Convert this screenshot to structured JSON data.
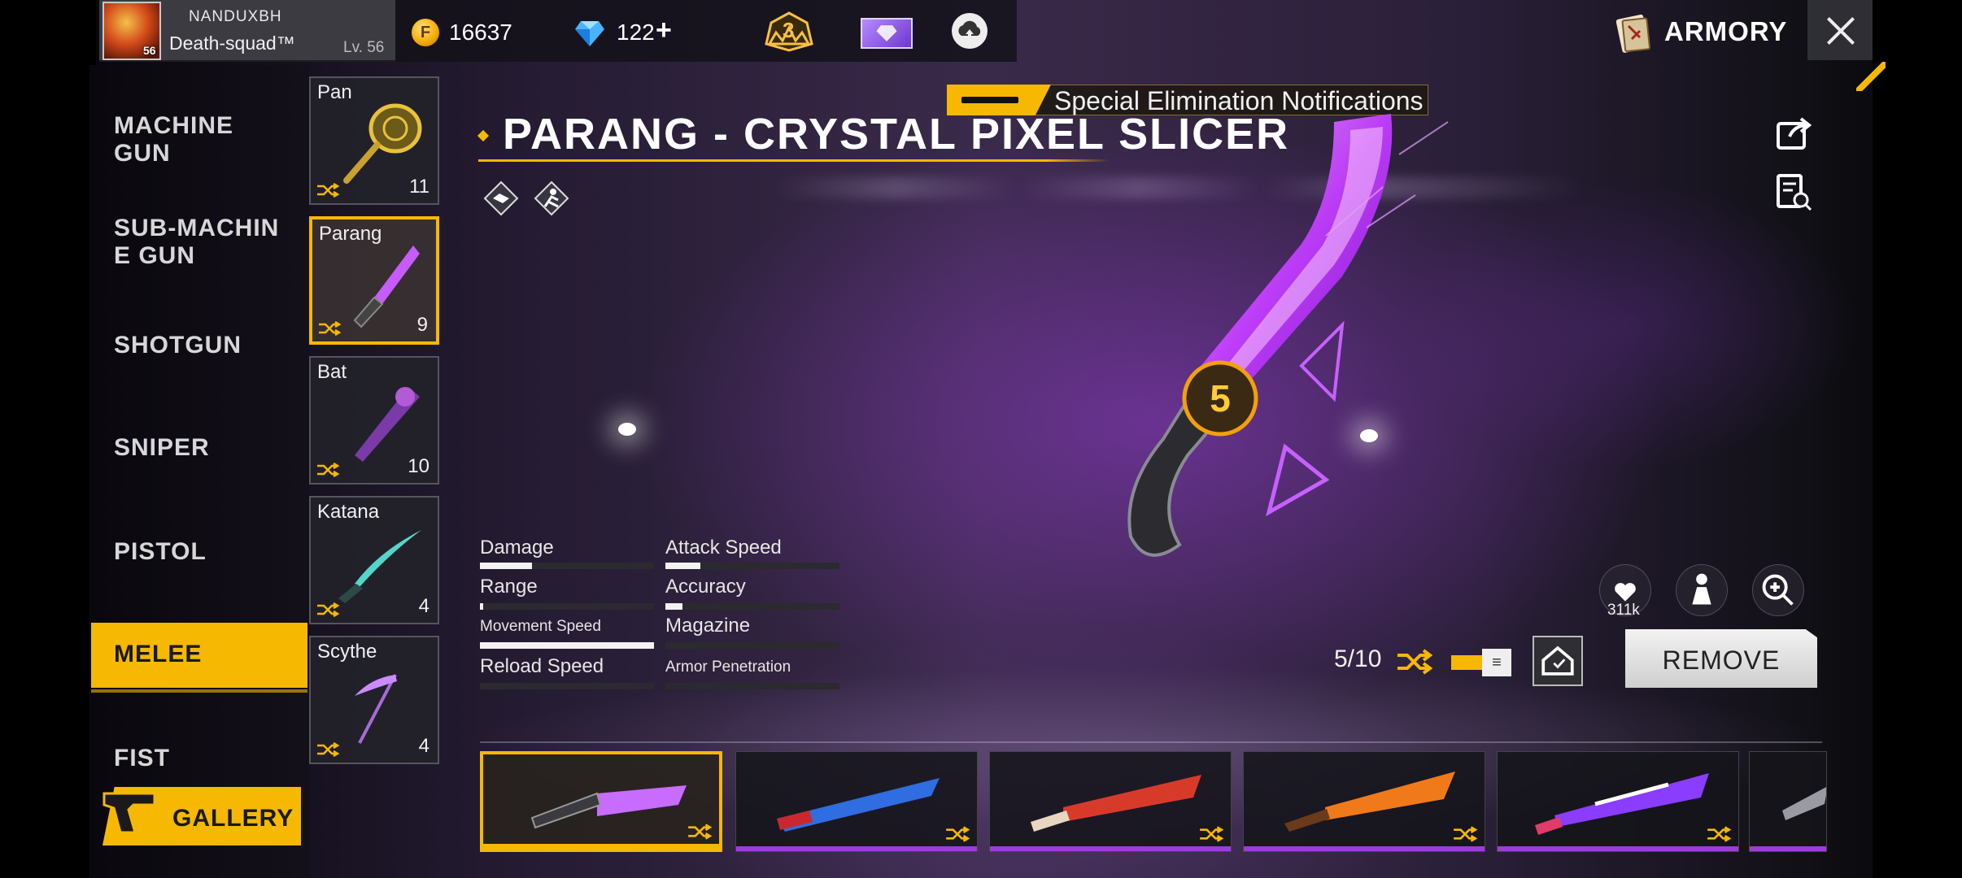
{
  "profile": {
    "name": "NANDUXBH",
    "guild": "Death-squad™",
    "level": "Lv. 56",
    "avatar_level": "56"
  },
  "currency": {
    "coins": "16637",
    "diamonds": "122",
    "plus": "+",
    "coin_symbol": "F"
  },
  "booyah_pass": {
    "value": "3"
  },
  "header": {
    "title": "ARMORY"
  },
  "categories": [
    {
      "label": "MACHINE\nGUN"
    },
    {
      "label": "SUB-MACHIN\nE GUN"
    },
    {
      "label": "SHOTGUN"
    },
    {
      "label": "SNIPER"
    },
    {
      "label": "PISTOL"
    },
    {
      "label": "MELEE",
      "active": true
    },
    {
      "label": "FIST"
    }
  ],
  "gallery": {
    "label": "GALLERY"
  },
  "weapons": [
    {
      "name": "Pan",
      "count": "11"
    },
    {
      "name": "Parang",
      "count": "9",
      "active": true
    },
    {
      "name": "Bat",
      "count": "10"
    },
    {
      "name": "Katana",
      "count": "4"
    },
    {
      "name": "Scythe",
      "count": "4"
    }
  ],
  "notification": {
    "text": "Special Elimination Notifications"
  },
  "weapon_title": "PARANG - CRYSTAL PIXEL SLICER",
  "stats": [
    {
      "label": "Damage",
      "value": 0.3
    },
    {
      "label": "Attack Speed",
      "value": 0.2
    },
    {
      "label": "Range",
      "value": 0.02
    },
    {
      "label": "Accuracy",
      "value": 0.1
    },
    {
      "label": "Movement Speed",
      "value": 1.0
    },
    {
      "label": "Magazine",
      "value": 0.0
    },
    {
      "label": "Reload Speed",
      "value": 0.0
    },
    {
      "label": "Armor Penetration",
      "value": 0.0
    }
  ],
  "actions": {
    "slots": "5/10",
    "likes": "311k",
    "remove_label": "REMOVE",
    "toggle_glyph": "≡"
  },
  "colors": {
    "accent": "#f6b800",
    "skin_underline": "#a13bd6",
    "blade_glow": "#d36bff"
  },
  "skins": [
    {
      "name": "crystal-pixel-slicer",
      "active": true
    },
    {
      "name": "blue-parang"
    },
    {
      "name": "red-parang"
    },
    {
      "name": "flame-parang"
    },
    {
      "name": "chrono-parang"
    },
    {
      "name": "partial-parang"
    }
  ]
}
